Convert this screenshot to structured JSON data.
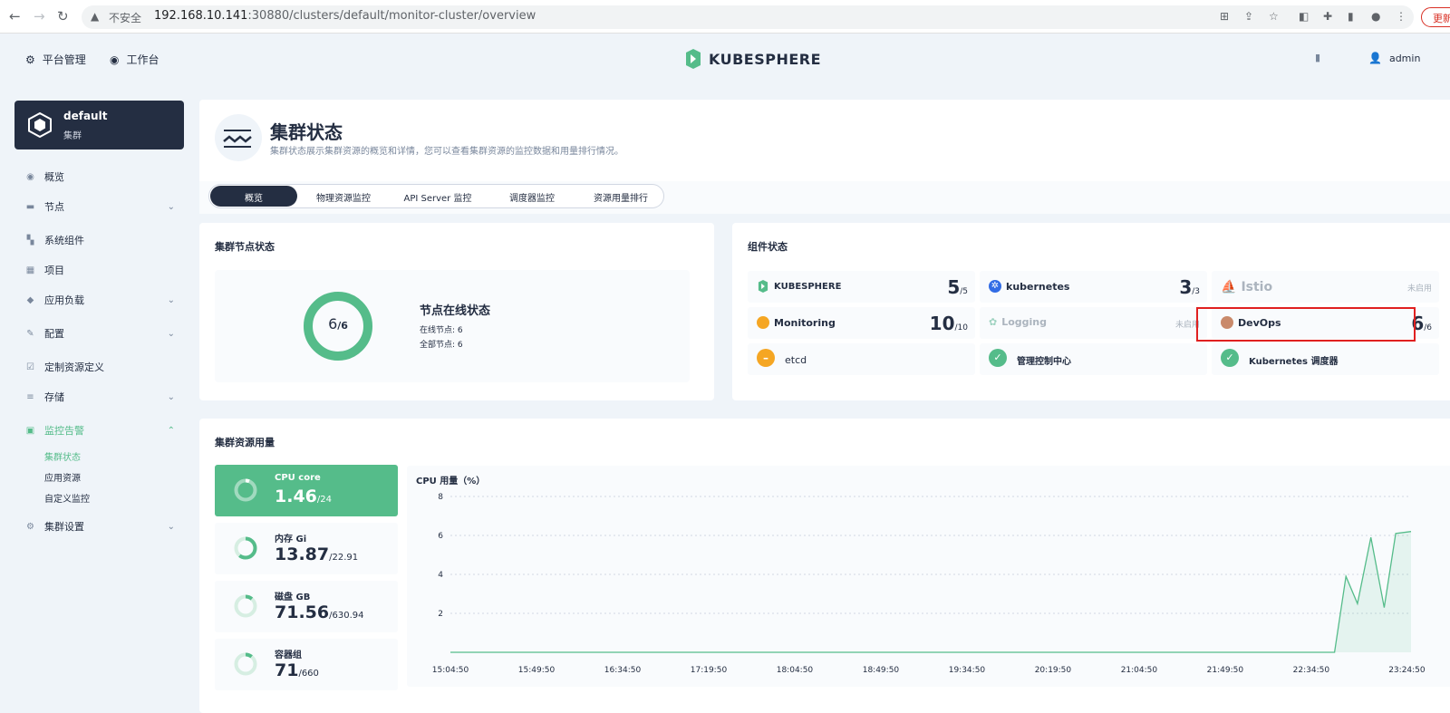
{
  "browser": {
    "insecure_label": "不安全",
    "url_host": "192.168.10.141",
    "url_rest": ":30880/clusters/default/monitor-cluster/overview",
    "update_label": "更新"
  },
  "topnav": {
    "platform": "平台管理",
    "workbench": "工作台",
    "logo": "KUBESPHERE",
    "user": "admin"
  },
  "sidebar": {
    "cluster_name": "default",
    "cluster_type": "集群",
    "items": [
      {
        "label": "概览",
        "icon": "dashboard-icon"
      },
      {
        "label": "节点",
        "icon": "nodes-icon",
        "expandable": true
      },
      {
        "label": "系统组件",
        "icon": "components-icon"
      },
      {
        "label": "项目",
        "icon": "project-icon"
      },
      {
        "label": "应用负载",
        "icon": "workload-icon",
        "expandable": true
      },
      {
        "label": "配置",
        "icon": "config-icon",
        "expandable": true
      },
      {
        "label": "定制资源定义",
        "icon": "crd-icon"
      },
      {
        "label": "存储",
        "icon": "storage-icon",
        "expandable": true
      },
      {
        "label": "监控告警",
        "icon": "monitor-icon",
        "expandable": true,
        "active": true
      },
      {
        "label": "集群设置",
        "icon": "settings-icon",
        "expandable": true
      }
    ],
    "monitor_sub": [
      "集群状态",
      "应用资源",
      "自定义监控"
    ]
  },
  "header": {
    "title": "集群状态",
    "description": "集群状态展示集群资源的概览和详情，您可以查看集群资源的监控数据和用量排行情况。"
  },
  "tabs": [
    "概览",
    "物理资源监控",
    "API Server 监控",
    "调度器监控",
    "资源用量排行"
  ],
  "node_status": {
    "title": "集群节点状态",
    "online": "6",
    "total": "6",
    "online_fraction": 1.0,
    "heading": "节点在线状态",
    "online_line": "在线节点: 6",
    "total_line": "全部节点: 6"
  },
  "components": {
    "title": "组件状态",
    "items": [
      {
        "name": "KUBESPHERE",
        "count": "5",
        "total": "/5",
        "icon": "kubesphere-icon"
      },
      {
        "name": "kubernetes",
        "count": "3",
        "total": "/3",
        "icon": "kubernetes-icon"
      },
      {
        "name": "Istio",
        "status": "未启用",
        "icon": "istio-icon"
      },
      {
        "name": "Monitoring",
        "count": "10",
        "total": "/10",
        "icon": "monitoring-icon"
      },
      {
        "name": "Logging",
        "status": "未启用",
        "icon": "logging-icon"
      },
      {
        "name": "DevOps",
        "count": "6",
        "total": "/6",
        "icon": "devops-icon"
      },
      {
        "name": "etcd",
        "icon": "warning-circle-icon"
      },
      {
        "name": "管理控制中心",
        "icon": "check-circle-icon"
      },
      {
        "name": "Kubernetes 调度器",
        "icon": "check-circle-icon"
      }
    ]
  },
  "resources": {
    "title": "集群资源用量",
    "stats": [
      {
        "label": "CPU core",
        "value": "1.46",
        "total": "/24",
        "fraction": 0.061
      },
      {
        "label": "内存 Gi",
        "value": "13.87",
        "total": "/22.91",
        "fraction": 0.605
      },
      {
        "label": "磁盘 GB",
        "value": "71.56",
        "total": "/630.94",
        "fraction": 0.113
      },
      {
        "label": "容器组",
        "value": "71",
        "total": "/660",
        "fraction": 0.108
      }
    ]
  },
  "chart_data": {
    "type": "area",
    "title": "CPU 用量（%）",
    "ylabel": "",
    "xlabel": "",
    "ylim": [
      0,
      8
    ],
    "yticks": [
      "8",
      "6",
      "4",
      "2"
    ],
    "ytick_values": [
      8,
      6,
      4,
      2
    ],
    "xticks": [
      "15:04:50",
      "15:49:50",
      "16:34:50",
      "17:19:50",
      "18:04:50",
      "18:49:50",
      "19:34:50",
      "20:19:50",
      "21:04:50",
      "21:49:50",
      "22:34:50",
      "23:24:50"
    ],
    "series": [
      {
        "x": [
          "15:04:50",
          "15:49:50",
          "16:34:50",
          "17:19:50",
          "18:04:50",
          "18:49:50",
          "19:34:50",
          "20:19:50",
          "21:04:50",
          "21:49:50",
          "22:34:50",
          "22:47:00",
          "22:53:00",
          "22:59:00",
          "23:06:00",
          "23:13:00",
          "23:19:00",
          "23:27:00"
        ],
        "values": [
          0,
          0,
          0,
          0,
          0,
          0,
          0,
          0,
          0,
          0,
          0,
          0,
          3.9,
          2.5,
          5.9,
          2.3,
          6.1,
          6.2
        ]
      }
    ],
    "color": "#55bc8a",
    "grid": true
  }
}
